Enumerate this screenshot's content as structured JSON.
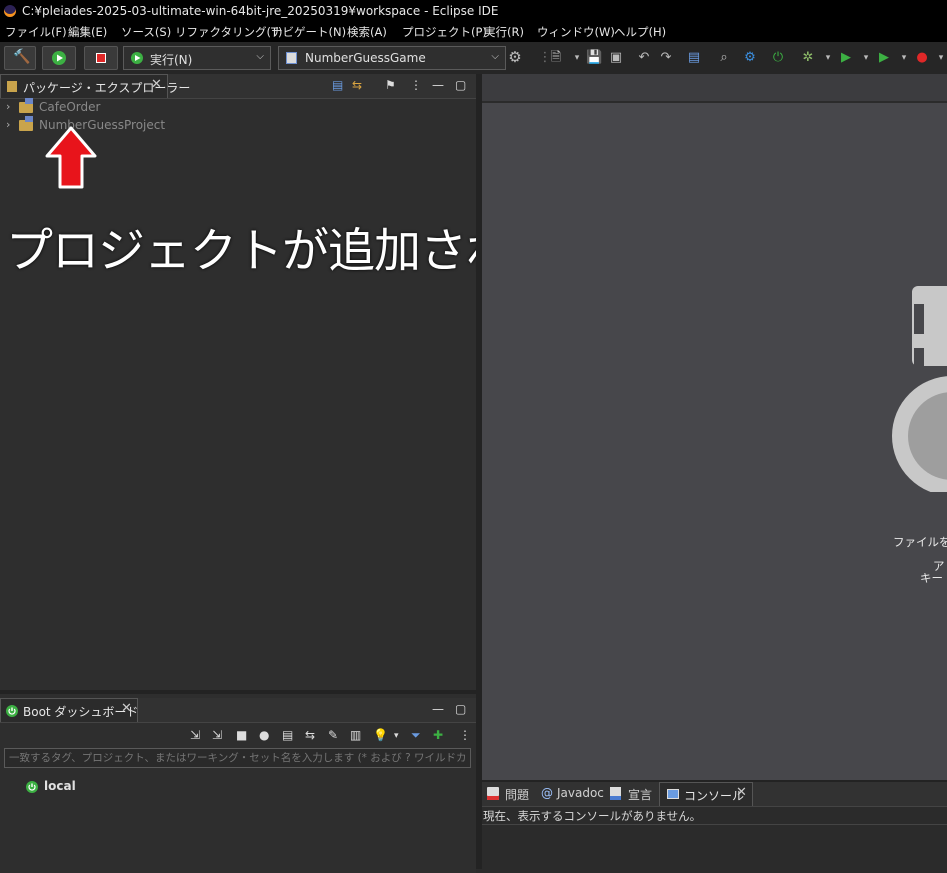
{
  "window": {
    "title": "C:¥pleiades-2025-03-ultimate-win-64bit-jre_20250319¥workspace - Eclipse IDE"
  },
  "menu": [
    "ファイル(F)",
    "編集(E)",
    "ソース(S)",
    "リファクタリング(T)",
    "ナビゲート(N)",
    "検索(A)",
    "プロジェクト(P)",
    "実行(R)",
    "ウィンドウ(W)",
    "ヘルプ(H)"
  ],
  "toolbar": {
    "run_combo": "実行(N)",
    "target_combo": "NumberGuessGame"
  },
  "package_explorer": {
    "tab_label": "パッケージ・エクスプローラー",
    "projects": [
      "CafeOrder",
      "NumberGuessProject"
    ]
  },
  "annotation": {
    "text": "プロジェクトが追加される"
  },
  "editor": {
    "hint_line1": "ファイルを開",
    "hint_line2": "ア",
    "hint_line3": "キー・ア"
  },
  "boot_dashboard": {
    "tab_label": "Boot ダッシュボード",
    "filter_placeholder": "一致するタグ、プロジェクト、またはワーキング・セット名を入力します (* および ? ワイルドカードを含む)",
    "items": [
      "local"
    ]
  },
  "bottom_panel": {
    "tabs": [
      "問題",
      "Javadoc",
      "宣言",
      "コンソール"
    ],
    "message": "現在、表示するコンソールがありません。"
  },
  "colors": {
    "annotation_arrow": "#e8141b",
    "run_green": "#3cb043",
    "stop_red": "#e02828",
    "boot_green": "#3cb043"
  }
}
